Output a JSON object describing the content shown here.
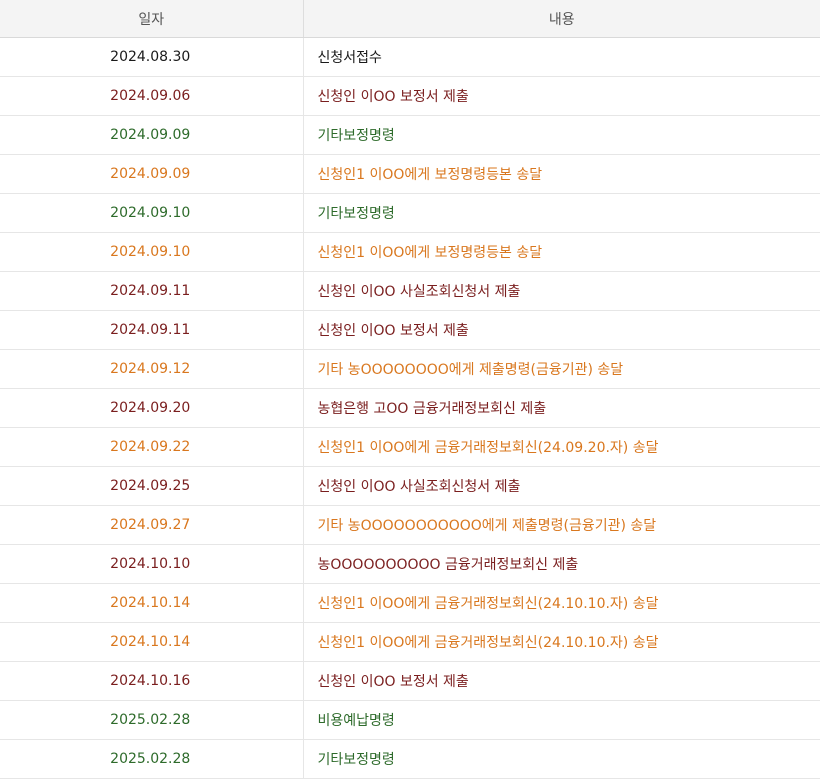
{
  "colors": {
    "black": "#1a1a1a",
    "maroon": "#7a1e1e",
    "green": "#2e6b2b",
    "orange": "#d9771e"
  },
  "header": {
    "date_label": "일자",
    "content_label": "내용"
  },
  "rows": [
    {
      "date": "2024.08.30",
      "content": "신청서접수",
      "tone": "black"
    },
    {
      "date": "2024.09.06",
      "content": "신청인 이OO 보정서 제출",
      "tone": "maroon"
    },
    {
      "date": "2024.09.09",
      "content": "기타보정명령",
      "tone": "green"
    },
    {
      "date": "2024.09.09",
      "content": "신청인1 이OO에게 보정명령등본 송달",
      "tone": "orange"
    },
    {
      "date": "2024.09.10",
      "content": "기타보정명령",
      "tone": "green"
    },
    {
      "date": "2024.09.10",
      "content": "신청인1 이OO에게 보정명령등본 송달",
      "tone": "orange"
    },
    {
      "date": "2024.09.11",
      "content": "신청인 이OO 사실조회신청서 제출",
      "tone": "maroon"
    },
    {
      "date": "2024.09.11",
      "content": "신청인 이OO 보정서 제출",
      "tone": "maroon"
    },
    {
      "date": "2024.09.12",
      "content": "기타 농OOOOOOOO에게 제출명령(금융기관) 송달",
      "tone": "orange"
    },
    {
      "date": "2024.09.20",
      "content": "농협은행 고OO 금융거래정보회신 제출",
      "tone": "maroon"
    },
    {
      "date": "2024.09.22",
      "content": "신청인1 이OO에게 금융거래정보회신(24.09.20.자) 송달",
      "tone": "orange"
    },
    {
      "date": "2024.09.25",
      "content": "신청인 이OO 사실조회신청서 제출",
      "tone": "maroon"
    },
    {
      "date": "2024.09.27",
      "content": "기타 농OOOOOOOOOOO에게 제출명령(금융기관) 송달",
      "tone": "orange"
    },
    {
      "date": "2024.10.10",
      "content": "농OOOOOOOOOO 금융거래정보회신 제출",
      "tone": "maroon"
    },
    {
      "date": "2024.10.14",
      "content": "신청인1 이OO에게 금융거래정보회신(24.10.10.자) 송달",
      "tone": "orange"
    },
    {
      "date": "2024.10.14",
      "content": "신청인1 이OO에게 금융거래정보회신(24.10.10.자) 송달",
      "tone": "orange"
    },
    {
      "date": "2024.10.16",
      "content": "신청인 이OO 보정서 제출",
      "tone": "maroon"
    },
    {
      "date": "2025.02.28",
      "content": "비용예납명령",
      "tone": "green"
    },
    {
      "date": "2025.02.28",
      "content": "기타보정명령",
      "tone": "green"
    }
  ]
}
